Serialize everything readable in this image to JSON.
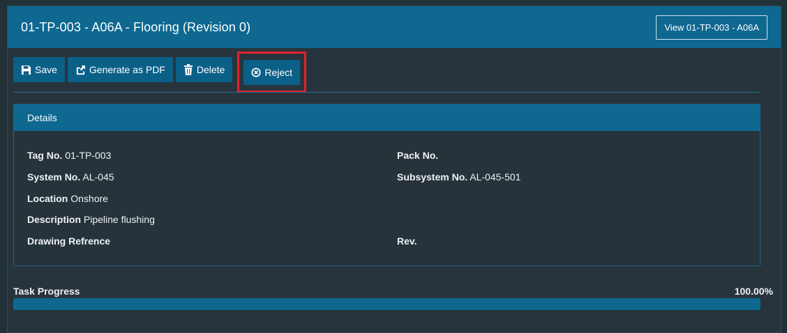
{
  "header": {
    "title": "01-TP-003 - A06A - Flooring (Revision 0)",
    "view_button": "View 01-TP-003 - A06A"
  },
  "toolbar": {
    "save_label": "Save",
    "pdf_label": "Generate as PDF",
    "delete_label": "Delete",
    "reject_label": "Reject"
  },
  "details": {
    "heading": "Details",
    "fields": {
      "tag_no": {
        "label": "Tag No.",
        "value": "01-TP-003"
      },
      "pack_no": {
        "label": "Pack No.",
        "value": ""
      },
      "system_no": {
        "label": "System No.",
        "value": "AL-045"
      },
      "subsystem_no": {
        "label": "Subsystem No.",
        "value": "AL-045-501"
      },
      "location": {
        "label": "Location",
        "value": "Onshore"
      },
      "description": {
        "label": "Description",
        "value": "Pipeline flushing"
      },
      "drawing_ref": {
        "label": "Drawing Refrence",
        "value": ""
      },
      "rev": {
        "label": "Rev.",
        "value": ""
      }
    }
  },
  "progress": {
    "label": "Task Progress",
    "value_text": "100.00%",
    "fraction": 1.0
  },
  "colors": {
    "accent": "#0e6890",
    "highlight": "#e2242b",
    "background": "#223038"
  }
}
